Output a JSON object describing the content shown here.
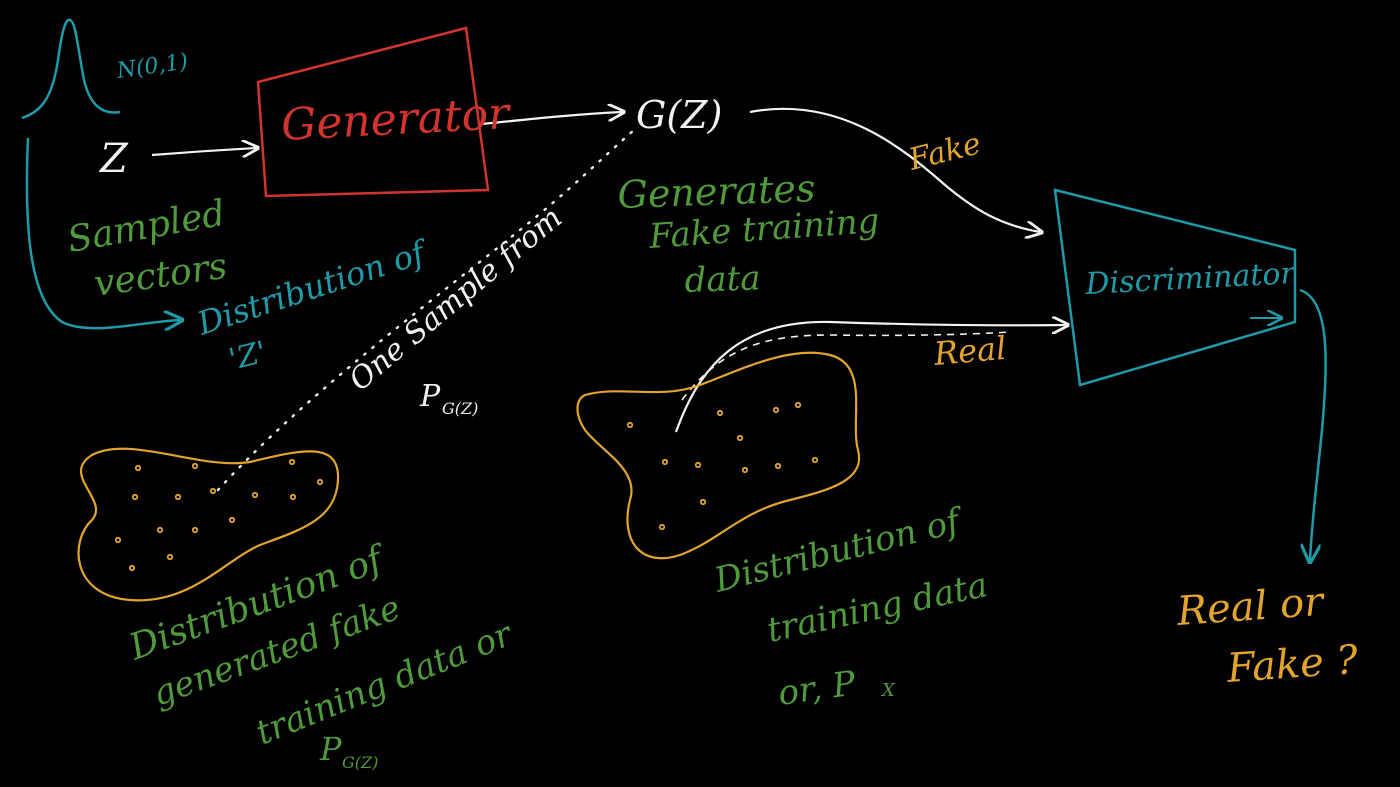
{
  "gaussian_label": "N(0,1)",
  "z": "Z",
  "generator": "Generator",
  "gz": "G(Z)",
  "fake_arrow": "Fake",
  "real_arrow": "Real",
  "discriminator": "Discriminator",
  "sampled_vectors": [
    "Sampled",
    "vectors"
  ],
  "distribution_of_z": [
    "Distribution of",
    "'Z'"
  ],
  "generates_fake": [
    "Generates",
    "Fake training",
    "data"
  ],
  "one_sample": [
    "One Sample from",
    "P",
    "G(Z)"
  ],
  "dist_generated": [
    "Distribution of",
    "generated fake",
    "training data or",
    "P",
    "G(Z)"
  ],
  "dist_training": [
    "Distribution of",
    "training data",
    "or, P",
    "X"
  ],
  "output": [
    "Real or",
    "Fake ?"
  ],
  "colors": {
    "background": "#000000",
    "generator_box": "#d1342c",
    "discriminator": "#1f9aa8",
    "annotations": "#4f9a3a",
    "distributions": "#e3a42e",
    "arrows": "#f2f2f2"
  }
}
